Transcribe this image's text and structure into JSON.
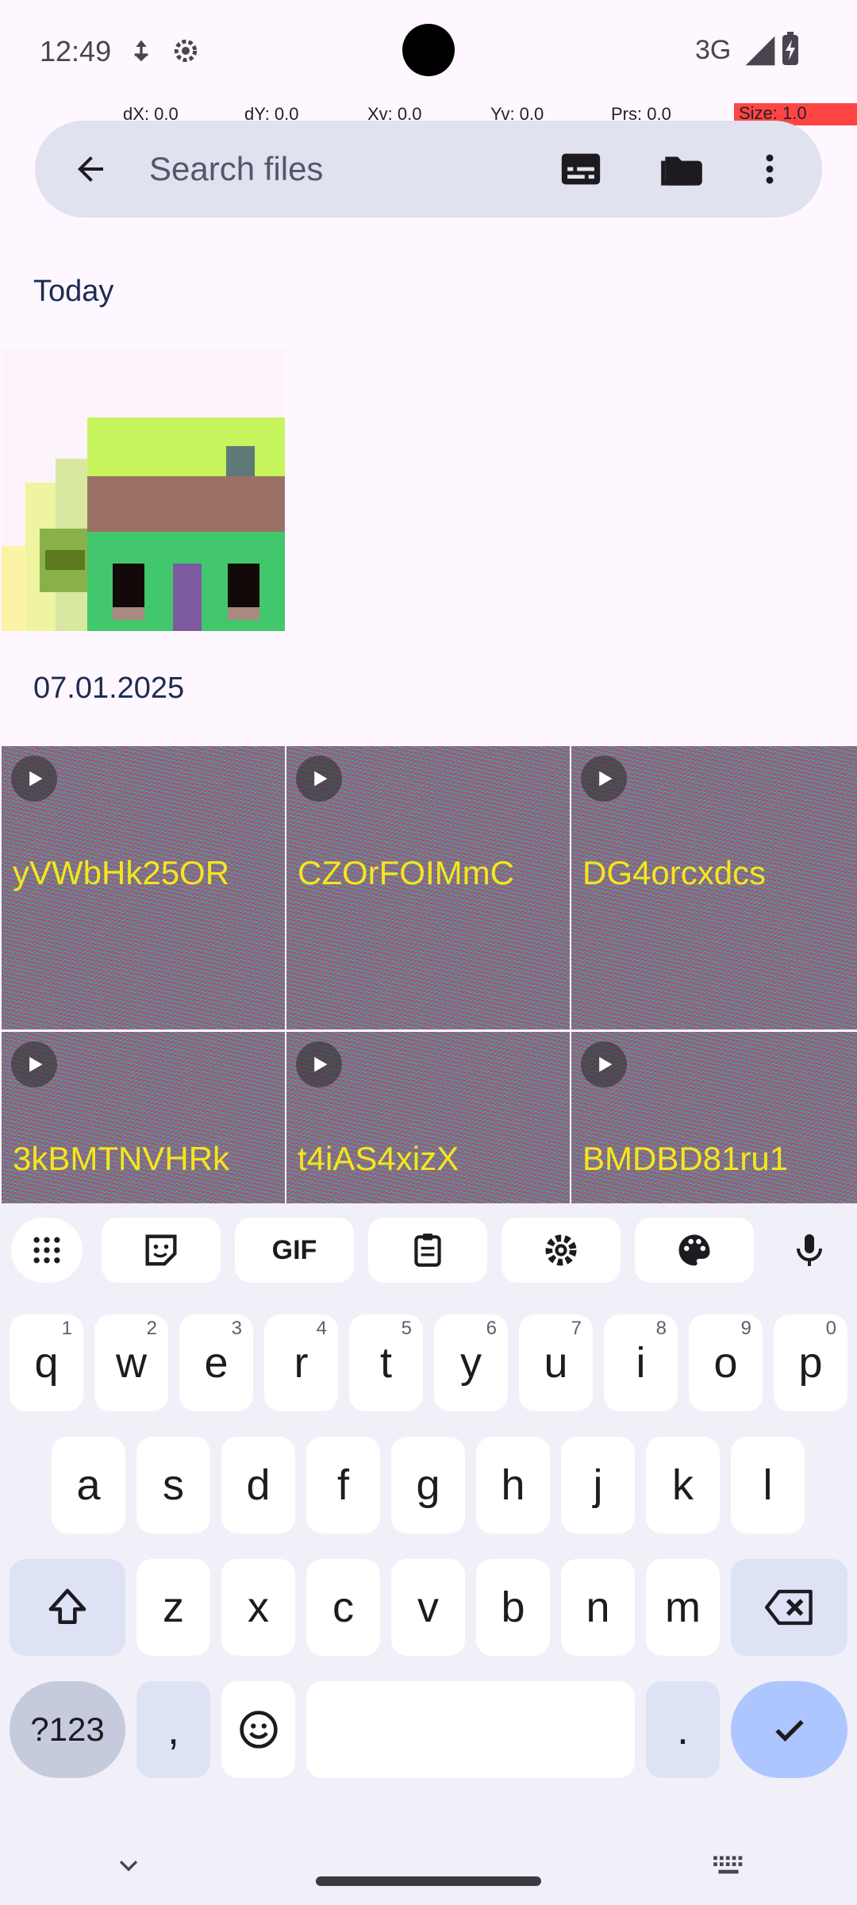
{
  "status_bar": {
    "time": "12:49",
    "network": "3G",
    "icons": [
      "data-saver-icon",
      "settings-gear-icon",
      "signal-icon",
      "battery-charging-icon"
    ]
  },
  "debug_overlay": {
    "dx": "dX: 0.0",
    "dy": "dY: 0.0",
    "xv": "Xv: 0.0",
    "yv": "Yv: 0.0",
    "prs": "Prs: 0.0",
    "size": "Size: 1.0"
  },
  "search": {
    "placeholder": "Search files",
    "back_icon": "arrow-back-icon",
    "actions": [
      "subtitles-icon",
      "folder-icon",
      "more-vert-icon"
    ]
  },
  "sections": [
    {
      "title": "Today"
    },
    {
      "title": "07.01.2025"
    }
  ],
  "videos": [
    {
      "name": "yVWbHk25OR"
    },
    {
      "name": "CZOrFOIMmC"
    },
    {
      "name": "DG4orcxdcs"
    },
    {
      "name": "3kBMTNVHRk"
    },
    {
      "name": "t4iAS4xizX"
    },
    {
      "name": "BMDBD81ru1"
    }
  ],
  "keyboard": {
    "toolbar": [
      "apps-grid-icon",
      "sticker-icon",
      "GIF",
      "clipboard-icon",
      "settings-icon",
      "palette-icon",
      "mic-icon"
    ],
    "row1": [
      {
        "key": "q",
        "hint": "1"
      },
      {
        "key": "w",
        "hint": "2"
      },
      {
        "key": "e",
        "hint": "3"
      },
      {
        "key": "r",
        "hint": "4"
      },
      {
        "key": "t",
        "hint": "5"
      },
      {
        "key": "y",
        "hint": "6"
      },
      {
        "key": "u",
        "hint": "7"
      },
      {
        "key": "i",
        "hint": "8"
      },
      {
        "key": "o",
        "hint": "9"
      },
      {
        "key": "p",
        "hint": "0"
      }
    ],
    "row2": [
      "a",
      "s",
      "d",
      "f",
      "g",
      "h",
      "j",
      "k",
      "l"
    ],
    "row3": [
      "z",
      "x",
      "c",
      "v",
      "b",
      "n",
      "m"
    ],
    "symbols_label": "?123",
    "comma": ",",
    "period": "."
  }
}
